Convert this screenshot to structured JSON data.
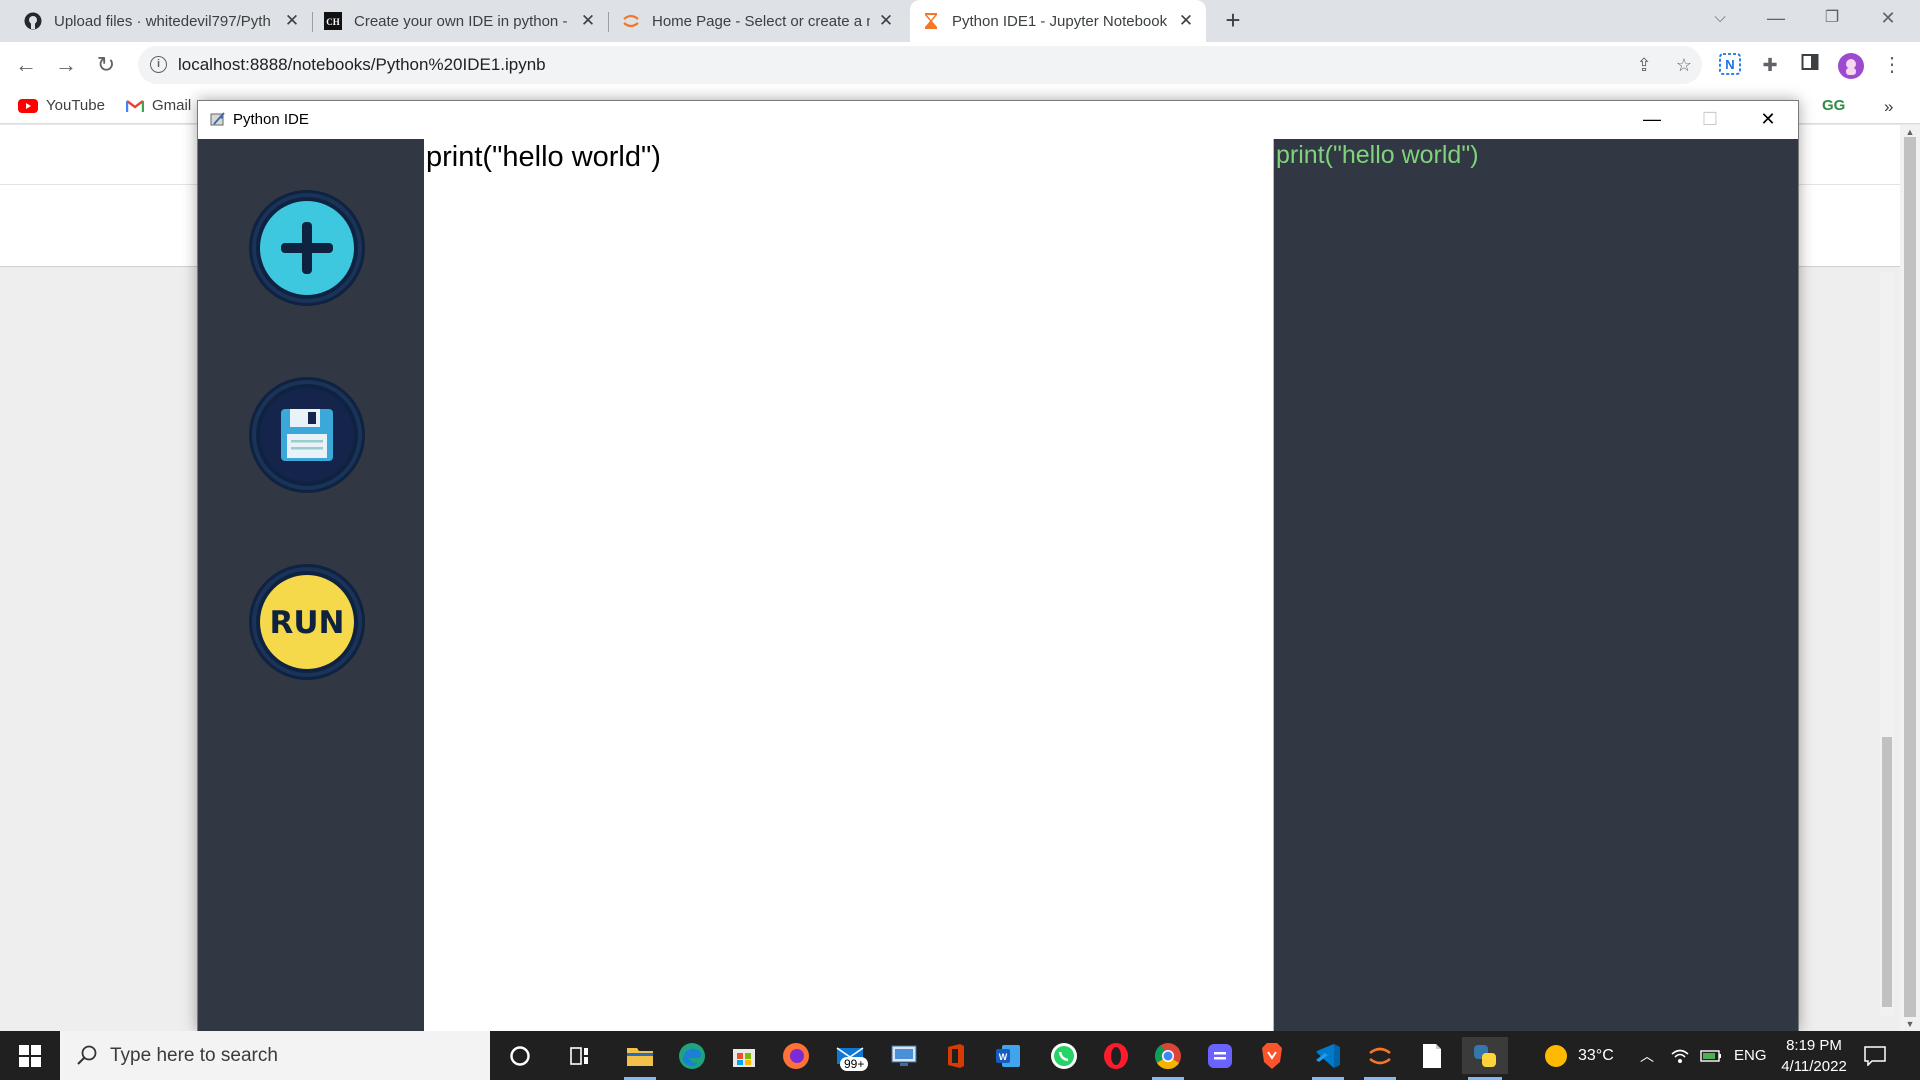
{
  "browser": {
    "tabs": [
      {
        "label": "Upload files · whitedevil797/Pyth",
        "icon": "github-icon"
      },
      {
        "label": "Create your own IDE in python - ",
        "icon": "ch-icon"
      },
      {
        "label": "Home Page - Select or create a n",
        "icon": "jupyter-icon"
      },
      {
        "label": "Python IDE1 - Jupyter Notebook",
        "icon": "hourglass-icon"
      }
    ],
    "new_tab_label": "+",
    "url": "localhost:8888/notebooks/Python%20IDE1.ipynb",
    "bookmarks": [
      {
        "label": "YouTube",
        "icon": "youtube-icon"
      },
      {
        "label": "Gmail",
        "icon": "gmail-icon"
      }
    ],
    "bookmarks_overflow": "»"
  },
  "ide": {
    "window_title": "Python IDE",
    "buttons": {
      "new": "+",
      "run": "RUN"
    },
    "editor_text": "print(\"hello world\")",
    "output_text": "print(\"hello world\")",
    "colors": {
      "sidebar_bg": "#313743",
      "new_button": "#3ec8e0",
      "save_button": "#15244a",
      "run_button": "#f5d94a",
      "output_text": "#7ed37b"
    }
  },
  "taskbar": {
    "search_placeholder": "Type here to search",
    "mail_badge": "99+",
    "weather": "33°C",
    "language": "ENG",
    "time": "8:19 PM",
    "date": "4/11/2022"
  }
}
